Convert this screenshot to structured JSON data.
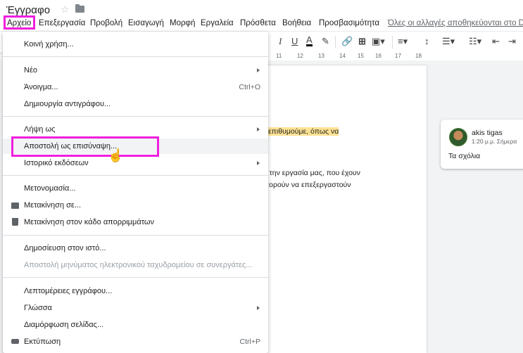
{
  "document": {
    "title": "Έγγραφο",
    "star_icon": "star-icon",
    "folder_icon": "folder-icon"
  },
  "menubar": {
    "items": [
      "Αρχείο",
      "Επεξεργασία",
      "Προβολή",
      "Εισαγωγή",
      "Μορφή",
      "Εργαλεία",
      "Πρόσθετα",
      "Βοήθεια",
      "Προσβασιμότητα"
    ],
    "save_status": "Όλες οι αλλαγές αποθηκεύονται στο Drive"
  },
  "toolbar": {
    "icons": [
      "italic-icon",
      "underline-icon",
      "text-color-icon",
      "highlight-icon",
      "link-icon",
      "add-comment-icon",
      "insert-image-icon",
      "align-icon",
      "line-spacing-icon",
      "numbered-list-icon",
      "bulleted-list-icon",
      "decrease-indent-icon",
      "increase-indent-icon"
    ]
  },
  "ruler": {
    "marks": [
      "11",
      "12",
      "13",
      "14",
      "15",
      "16",
      "17",
      "18"
    ]
  },
  "document_body": {
    "lines": [
      "επιθυμούμε, όπως να",
      "με την εργασία μας, που έχουν",
      "μπορούν να επεξεργαστούν"
    ]
  },
  "comment": {
    "author": "akis tigas",
    "time": "1:20 μ.μ. Σήμερα",
    "text": "Τα σχόλια"
  },
  "file_menu": {
    "share": "Κοινή χρήση...",
    "new": "Νέο",
    "open": "Άνοιγμα...",
    "open_shortcut": "Ctrl+O",
    "make_copy": "Δημιουργία αντιγράφου...",
    "download": "Λήψη ως",
    "email_attachment": "Αποστολή ως επισύναψη...",
    "version_history": "Ιστορικό εκδόσεων",
    "rename": "Μετονομασία...",
    "move": "Μετακίνηση σε...",
    "move_to_trash": "Μετακίνηση στον κάδο απορριμμάτων",
    "publish": "Δημοσίευση στον ιστό...",
    "email_collaborators": "Αποστολή μηνύματος ηλεκτρονικού ταχυδρομείου σε συνεργάτες...",
    "details": "Λεπτομέρειες εγγράφου...",
    "language": "Γλώσσα",
    "page_setup": "Διαμόρφωση σελίδας...",
    "print": "Εκτύπωση",
    "print_shortcut": "Ctrl+P"
  },
  "colors": {
    "highlight_box": "#f01fde",
    "text_highlight": "#fde293"
  }
}
